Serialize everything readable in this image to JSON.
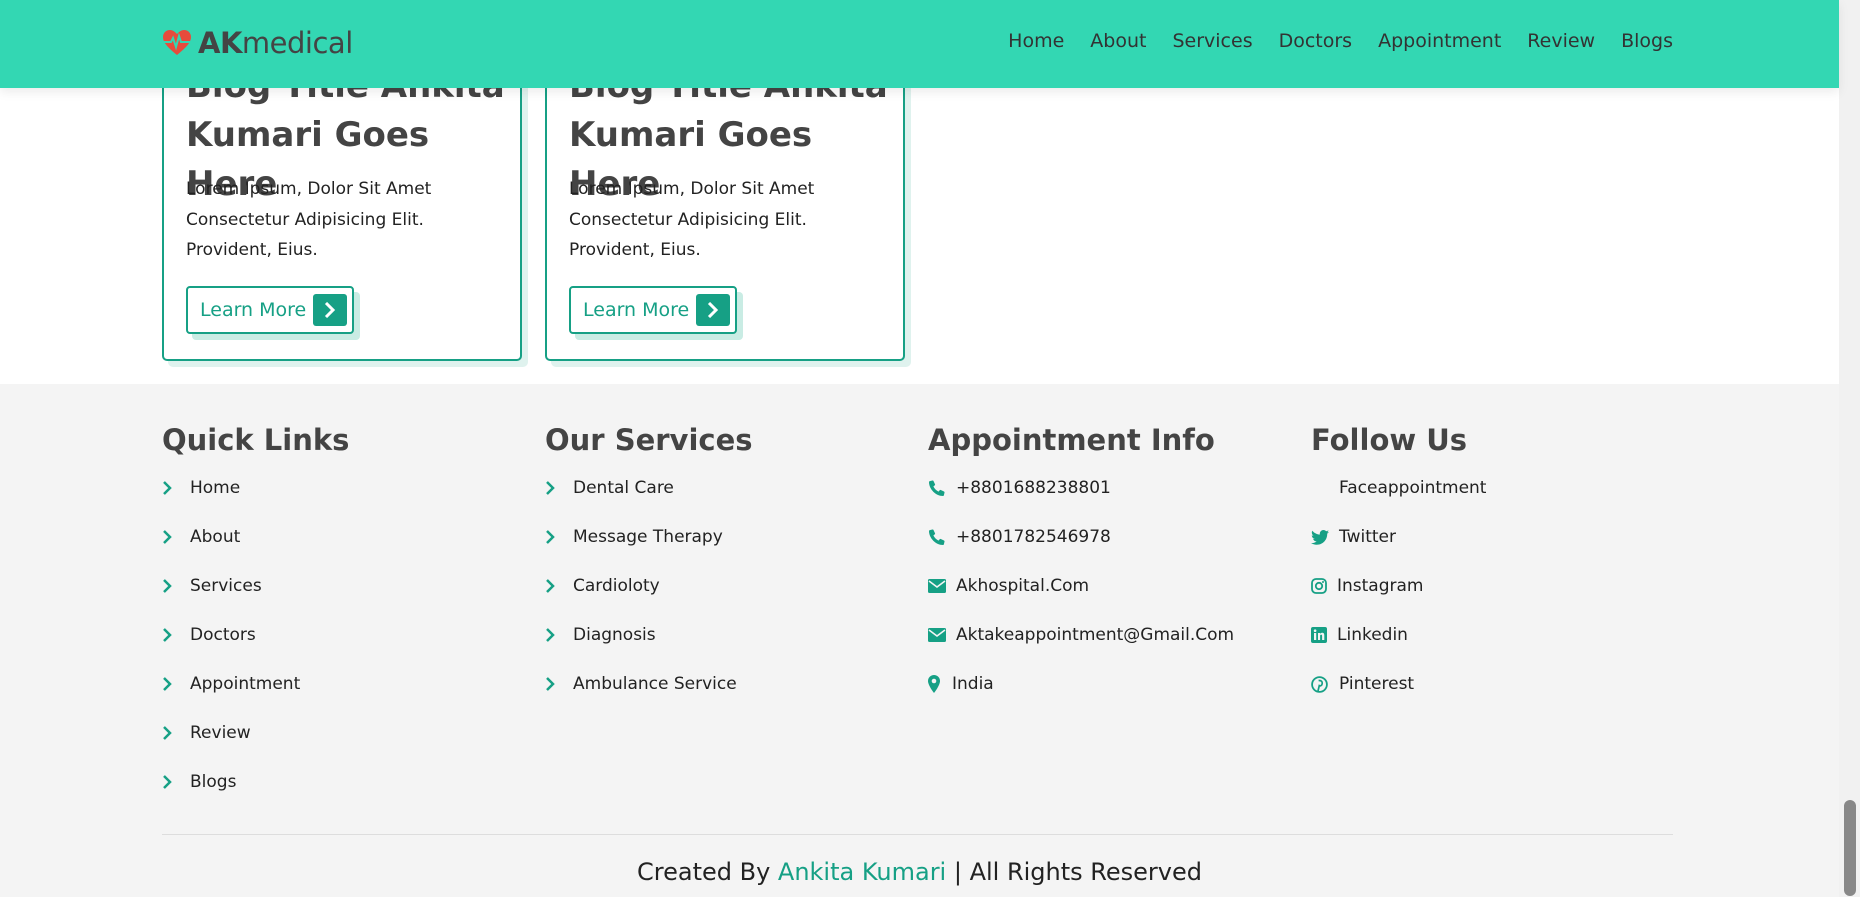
{
  "brand": {
    "strong": "AK",
    "light": "medical"
  },
  "nav": [
    "Home",
    "About",
    "Services",
    "Doctors",
    "Appointment",
    "Review",
    "Blogs"
  ],
  "blog_cards": [
    {
      "title_line1": "Blog Title Ankita",
      "title_line2": "Kumari Goes Here",
      "text": "Lorem Ipsum, Dolor Sit Amet Consectetur Adipisicing Elit. Provident, Eius.",
      "button": "Learn More"
    },
    {
      "title_line1": "Blog Title Ankita",
      "title_line2": "Kumari Goes Here",
      "text": "Lorem Ipsum, Dolor Sit Amet Consectetur Adipisicing Elit. Provident, Eius.",
      "button": "Learn More"
    }
  ],
  "footer": {
    "quick_links": {
      "heading": "Quick Links",
      "items": [
        "Home",
        "About",
        "Services",
        "Doctors",
        "Appointment",
        "Review",
        "Blogs"
      ]
    },
    "services": {
      "heading": "Our Services",
      "items": [
        "Dental Care",
        "Message Therapy",
        "Cardioloty",
        "Diagnosis",
        "Ambulance Service"
      ]
    },
    "appointment": {
      "heading": "Appointment Info",
      "items": [
        {
          "icon": "phone-icon",
          "text": "+8801688238801"
        },
        {
          "icon": "phone-icon",
          "text": "+8801782546978"
        },
        {
          "icon": "envelope-icon",
          "text": "Akhospital.Com"
        },
        {
          "icon": "envelope-icon",
          "text": "Aktakeappointment@Gmail.Com"
        },
        {
          "icon": "map-marker-icon",
          "text": "India"
        }
      ]
    },
    "follow": {
      "heading": "Follow Us",
      "items": [
        {
          "icon": "facebook-icon",
          "text": "Faceappointment"
        },
        {
          "icon": "twitter-icon",
          "text": "Twitter"
        },
        {
          "icon": "instagram-icon",
          "text": "Instagram"
        },
        {
          "icon": "linkedin-icon",
          "text": "Linkedin"
        },
        {
          "icon": "pinterest-icon",
          "text": "Pinterest"
        }
      ]
    },
    "credit": {
      "prefix": "Created By ",
      "name": "Ankita Kumari",
      "suffix": " | All Rights Reserved"
    }
  },
  "colors": {
    "header_bg": "#33d7b3",
    "accent": "#16a085",
    "footer_bg": "#f4f4f4"
  }
}
